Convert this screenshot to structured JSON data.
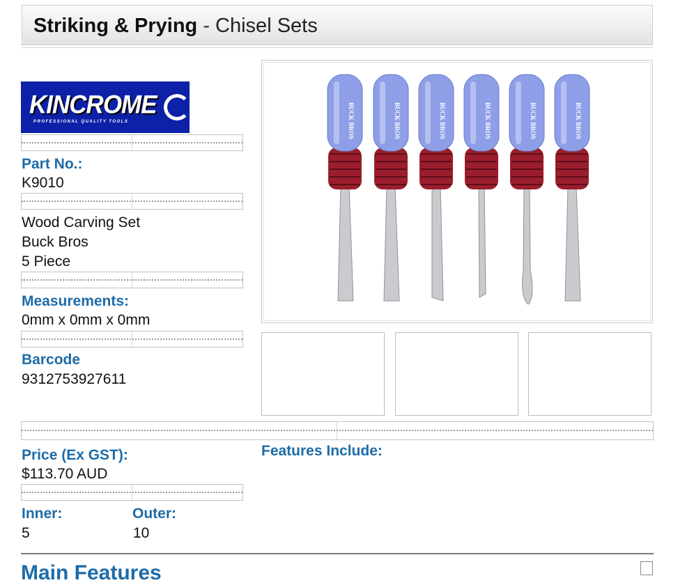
{
  "header": {
    "title_bold": "Striking & Prying",
    "title_separator": " - ",
    "title_sub": "Chisel Sets"
  },
  "logo": {
    "brand": "KINCROME",
    "tagline": "PROFESSIONAL QUALITY TOOLS"
  },
  "product": {
    "part_no_label": "Part No.:",
    "part_no": "K9010",
    "description_lines": [
      "Wood Carving Set",
      "Buck Bros",
      "5 Piece"
    ],
    "measurements_label": "Measurements:",
    "measurements": "0mm x 0mm x 0mm",
    "barcode_label": "Barcode",
    "barcode": "9312753927611",
    "price_label": "Price (Ex GST):",
    "price": "$113.70 AUD",
    "inner_label": "Inner:",
    "inner": "5",
    "outer_label": "Outer:",
    "outer": "10"
  },
  "features": {
    "include_label": "Features Include:",
    "main_label": "Main Features"
  },
  "image": {
    "handle_text": "BUCK BROS",
    "handle_color": "#8e9fe8",
    "grip_color": "#9a1e2c",
    "blade_color": "#c9cbcf"
  }
}
